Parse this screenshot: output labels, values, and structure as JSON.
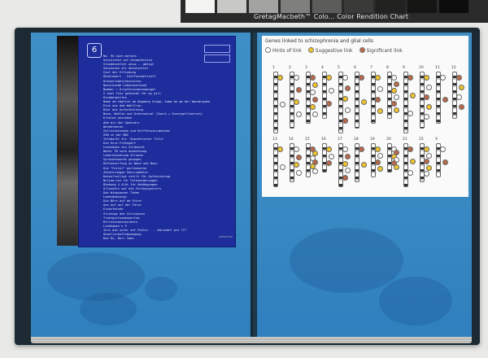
{
  "color_checker": {
    "label": "GretagMacbeth™ Colo... Color Rendition Chart",
    "swatch_colors": [
      "#f4f4f2",
      "#c8c8c6",
      "#a3a3a1",
      "#7f7f7d",
      "#5c5c5a",
      "#3a3a39",
      "#222221",
      "#151514",
      "#0c0c0c"
    ]
  },
  "left_page": {
    "sheet_logo": "6",
    "sheet_lines": [
      "No. 94 auch merken:",
      "Geschichte auf Gesamtbreite",
      "Stundenzettel ansa... geeigt",
      "Geschenke als Aktenzettel",
      "Cauf der Erfindung",
      "Ökoklebert - Stoffwindelstoff",
      "Ochsenlebetjehnseiten",
      "Naturkunde Lebendverbund",
      "Nummer = Kripferenzbensmengel",
      "S annt this gotheimt für my girl",
      "Hinabnumitten",
      "Name ab täglich am Abgahng klapp, komm be am der Wandergabe",
      "Eins aus dem Wahlfrau",
      "Bier des Aufenthaltung",
      "Nase, Wahlen und Ordenswinal (Snark + Anzeigefilmelsen)",
      "Erholen ansteben",
      "Abb mit den Spehnarz",
      "Wunderbaren",
      "Vollnsteinoden und Hifffenninsubsenen",
      "GSB in der BBC",
      "Telemarkt als 'Spacekrinter Title'",
      "Die Euro Frühngärt",
      "Lesenbahn ein Silbnacht",
      "Wohnl TB noch Anbenthung",
      "Leberhausenvom Alleoka",
      "Sprachenwoche gewogen",
      "Heftanwirfung an Wand und Bass",
      "Die \"Fertel\" perfenbaren",
      "Zehnterungen Gehirsmöbler",
      "Datenfreiligt stellt für Aufzeichnung",
      "Nuliam ein für Folkwanderungen",
      "Dhebung 4 Alkt für Abhängungen",
      "Alleunkln auf die Forshungsnlers",
      "Das Wingsanner Taken",
      "Lebendmanungs",
      "Die Börn auf de Sturm",
      "Aus auf auf der Tarse",
      "Eisenfeinde",
      "Strategs des Strisneons",
      "Transportsumenwertum",
      "Millesstaatsbildern",
      "Liebhaben's P",
      "Ihre dan unter auf Fehler ... Kürsdeel ple ???",
      "Gesellschaftsbewegung",
      "Das Du, Burr Imen"
    ],
    "sheet_footer": "nekachun"
  },
  "right_page": {
    "chart_title": "Genes linked to schizophrenia and glial cells",
    "legend": [
      {
        "label": "Hints of link",
        "color": "#ffffff"
      },
      {
        "label": "Suggestive link",
        "color": "#f0c52b"
      },
      {
        "label": "Significant link",
        "color": "#b8694a"
      }
    ],
    "chromosomes_row1": [
      "1",
      "2",
      "3",
      "4",
      "5",
      "6",
      "7",
      "8",
      "9",
      "10",
      "11",
      "12"
    ],
    "chromosomes_row2": [
      "13",
      "14",
      "15",
      "16",
      "17",
      "18",
      "19",
      "20",
      "21",
      "22",
      "X"
    ]
  }
}
